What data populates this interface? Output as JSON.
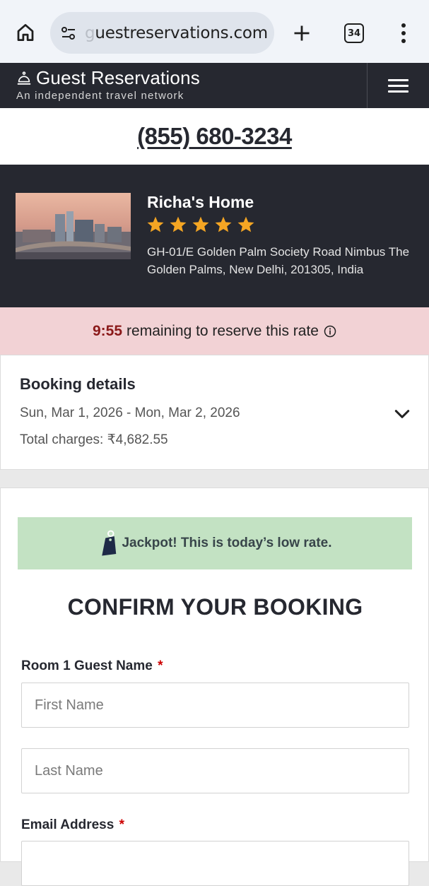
{
  "browser": {
    "url_prefix": "g",
    "url_main": "uestreservations.com",
    "tab_count": "34"
  },
  "header": {
    "title": "Guest Reservations",
    "subtitle": "An independent travel network"
  },
  "phone": "(855) 680-3234",
  "hotel": {
    "name": "Richa's Home",
    "rating": 5,
    "address": "GH-01/E Golden Palm Society Road Nimbus The Golden Palms, New Delhi, 201305, India"
  },
  "timer": {
    "time": "9:55",
    "text": "remaining to reserve this rate"
  },
  "booking": {
    "title": "Booking details",
    "dates": "Sun, Mar 1, 2026 - Mon, Mar 2, 2026",
    "total": "Total charges: ₹4,682.55"
  },
  "deal": {
    "text": "Jackpot! This is today’s low rate."
  },
  "form": {
    "title": "CONFIRM YOUR BOOKING",
    "guest_label": "Room 1 Guest Name",
    "first_name_placeholder": "First Name",
    "last_name_placeholder": "Last Name",
    "email_label": "Email Address",
    "required_mark": "*"
  },
  "colors": {
    "header_bg": "#262830",
    "timer_bg": "#f2d2d5",
    "timer_accent": "#8b1a1a",
    "deal_bg": "#c3e2c3",
    "star": "#f5a623",
    "required": "#cc0000"
  }
}
